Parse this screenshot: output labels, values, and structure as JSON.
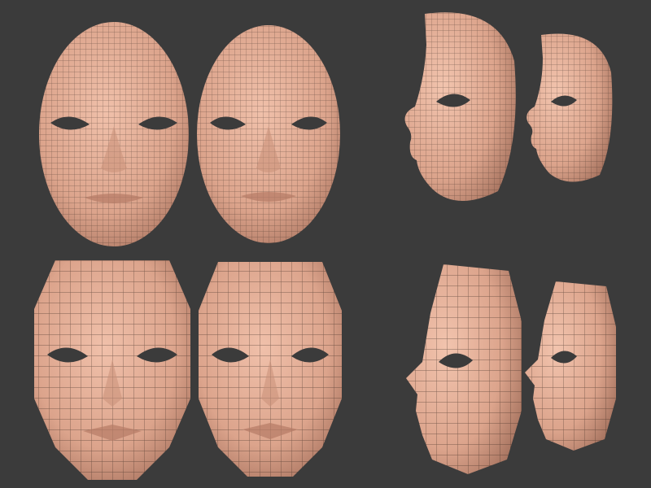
{
  "scene": {
    "background": "#3b3b3b",
    "skin": "#e4ad96",
    "skin_shadow": "#b07a64",
    "wire": "#3a2a22",
    "eye_hole": "#3b3b3b",
    "rows": [
      {
        "name": "high-resolution-mesh",
        "views": [
          "front",
          "front",
          "side",
          "side"
        ]
      },
      {
        "name": "low-resolution-mesh",
        "views": [
          "front",
          "front",
          "side",
          "side"
        ]
      }
    ]
  }
}
